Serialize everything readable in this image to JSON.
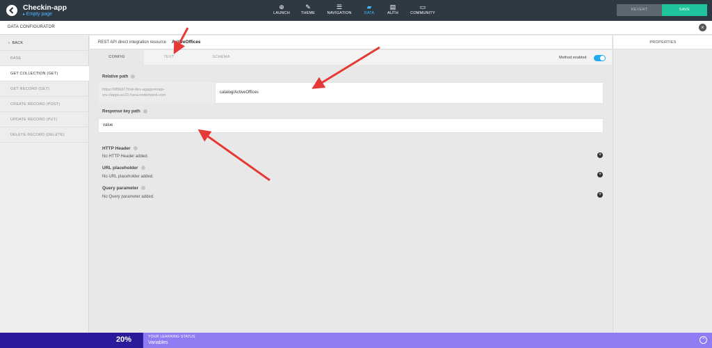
{
  "app": {
    "title": "Checkin-app",
    "subtitle": "Empty page"
  },
  "nav": [
    {
      "label": "LAUNCH",
      "icon": "rocket-icon",
      "glyph": "⊕"
    },
    {
      "label": "THEME",
      "icon": "brush-icon",
      "glyph": "✎"
    },
    {
      "label": "NAVIGATION",
      "icon": "list-icon",
      "glyph": "☰"
    },
    {
      "label": "DATA",
      "icon": "folder-icon",
      "glyph": "▰"
    },
    {
      "label": "AUTH",
      "icon": "document-icon",
      "glyph": "▤"
    },
    {
      "label": "COMMUNITY",
      "icon": "chat-icon",
      "glyph": "▭"
    }
  ],
  "actions": {
    "revert": "REVERT",
    "save": "SAVE"
  },
  "configurator": {
    "title": "DATA CONFIGURATOR",
    "close_glyph": "×"
  },
  "sidebar": {
    "back": "BACK",
    "items": [
      {
        "label": "BASE"
      },
      {
        "label": "GET COLLECTION (GET)"
      },
      {
        "label": "GET RECORD (GET)"
      },
      {
        "label": "CREATE RECORD (POST)"
      },
      {
        "label": "UPDATE RECORD (PUT)"
      },
      {
        "label": "DELETE RECORD (DELETE)"
      }
    ],
    "active_index": 1
  },
  "resource": {
    "label": "REST API direct integration resource",
    "name": "ActiveOffices"
  },
  "tabs": [
    {
      "label": "CONFIG"
    },
    {
      "label": "TEST"
    },
    {
      "label": "SCHEMA"
    }
  ],
  "active_tab": 0,
  "method": {
    "label": "Method enabled",
    "enabled": true
  },
  "relative_path": {
    "label": "Relative path",
    "base_url_line1": "https://9f56d77trial-dev-appgyverapi-",
    "base_url_line2": "srv.cfapps.us10.hana.ondemand.com",
    "value": "catalog/ActiveOffices"
  },
  "response_key": {
    "label": "Response key path",
    "value": "value"
  },
  "options": [
    {
      "title": "HTTP Header",
      "desc": "No HTTP Header added."
    },
    {
      "title": "URL placeholder",
      "desc": "No URL placeholder added."
    },
    {
      "title": "Query parameter",
      "desc": "No Query parameter added."
    }
  ],
  "properties": {
    "title": "PROPERTIES"
  },
  "learning": {
    "percent": "20%",
    "label": "YOUR LEARNING STATUS",
    "value": "Variables",
    "arrow_glyph": "⌃"
  },
  "colors": {
    "accent": "#43b9f7",
    "save": "#1fc49c",
    "annotation": "#e53935",
    "learning": "#8f7cf2"
  }
}
